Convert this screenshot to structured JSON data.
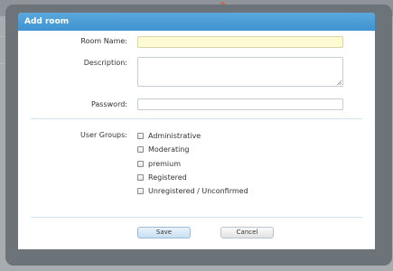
{
  "dialog": {
    "title": "Add room",
    "fields": {
      "room_name": {
        "label": "Room Name:",
        "value": ""
      },
      "description": {
        "label": "Description:",
        "value": ""
      },
      "password": {
        "label": "Password:",
        "value": ""
      }
    },
    "user_groups": {
      "label": "User Groups:",
      "options": [
        {
          "label": "Administrative",
          "checked": false
        },
        {
          "label": "Moderating",
          "checked": false
        },
        {
          "label": "premium",
          "checked": false
        },
        {
          "label": "Registered",
          "checked": false
        },
        {
          "label": "Unregistered / Unconfirmed",
          "checked": false
        }
      ]
    },
    "buttons": {
      "save": "Save",
      "cancel": "Cancel"
    }
  },
  "colors": {
    "titlebar": "#4a9dd7",
    "room_name_bg": "#fdfbd1",
    "overlay": "#6c7379"
  },
  "icons": [
    "checkbox-icon",
    "resize-grip-icon"
  ]
}
